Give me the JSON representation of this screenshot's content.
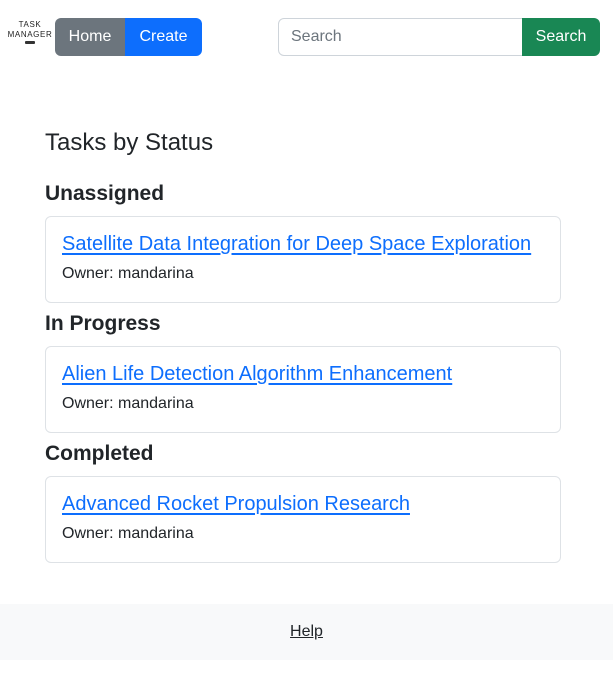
{
  "logo": {
    "line1": "TASK",
    "line2": "MANAGER"
  },
  "nav": {
    "home_label": "Home",
    "create_label": "Create"
  },
  "search": {
    "placeholder": "Search",
    "button_label": "Search"
  },
  "main": {
    "title": "Tasks by Status",
    "groups": [
      {
        "status": "Unassigned",
        "tasks": [
          {
            "title": "Satellite Data Integration for Deep Space Exploration",
            "owner": "Owner: mandarina"
          }
        ]
      },
      {
        "status": "In Progress",
        "tasks": [
          {
            "title": "Alien Life Detection Algorithm Enhancement",
            "owner": "Owner: mandarina"
          }
        ]
      },
      {
        "status": "Completed",
        "tasks": [
          {
            "title": "Advanced Rocket Propulsion Research",
            "owner": "Owner: mandarina"
          }
        ]
      }
    ]
  },
  "footer": {
    "help_label": "Help"
  },
  "colors": {
    "primary": "#0d6efd",
    "secondary": "#6c757d",
    "success": "#198754",
    "footer_bg": "#f8f9fa"
  }
}
